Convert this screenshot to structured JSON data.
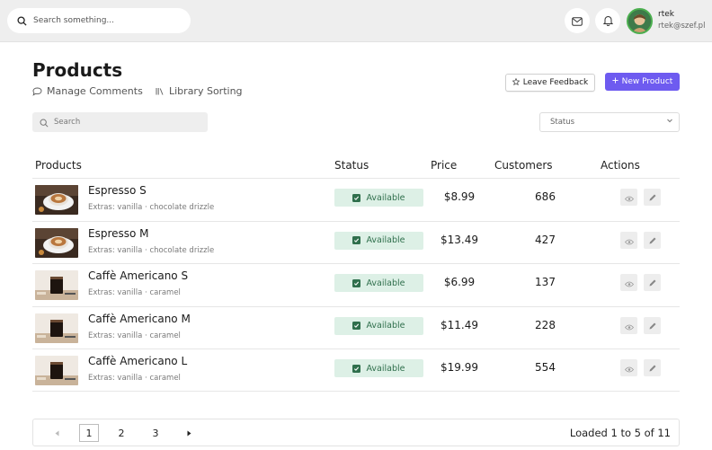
{
  "topbar": {
    "search_placeholder": "Search something...",
    "user": {
      "name": "rtek",
      "email": "rtek@szef.pl"
    }
  },
  "header": {
    "title": "Products",
    "links": {
      "manage_comments": "Manage Comments",
      "library_sorting": "Library Sorting"
    },
    "feedback_button": "Leave Feedback",
    "new_button": "New Product"
  },
  "filters": {
    "search_placeholder": "Search",
    "status_value": "Status"
  },
  "table": {
    "columns": {
      "products": "Products",
      "status": "Status",
      "price": "Price",
      "customers": "Customers",
      "actions": "Actions"
    },
    "rows": [
      {
        "name": "Espresso S",
        "extras": "Extras: vanilla · chocolate drizzle",
        "status": "Available",
        "price": "$8.99",
        "customers": "686",
        "image": "espresso-cup"
      },
      {
        "name": "Espresso M",
        "extras": "Extras: vanilla · chocolate drizzle",
        "status": "Available",
        "price": "$13.49",
        "customers": "427",
        "image": "espresso-cup"
      },
      {
        "name": "Caffè Americano S",
        "extras": "Extras: vanilla · caramel",
        "status": "Available",
        "price": "$6.99",
        "customers": "137",
        "image": "americano-glass"
      },
      {
        "name": "Caffè Americano M",
        "extras": "Extras: vanilla · caramel",
        "status": "Available",
        "price": "$11.49",
        "customers": "228",
        "image": "americano-glass"
      },
      {
        "name": "Caffè Americano L",
        "extras": "Extras: vanilla · caramel",
        "status": "Available",
        "price": "$19.99",
        "customers": "554",
        "image": "americano-glass"
      }
    ]
  },
  "pagination": {
    "pages": [
      "1",
      "2",
      "3"
    ],
    "current_page": "1",
    "info": "Loaded 1 to 5 of 11"
  },
  "colors": {
    "accent": "#6e5bf0",
    "status_bg": "#ddf0e6",
    "status_text": "#2f6f4c",
    "topbar_bg": "#eeeeee"
  },
  "icons": [
    "search-icon",
    "mail-icon",
    "bell-icon",
    "comment-icon",
    "library-icon",
    "star-icon",
    "plus-icon",
    "chevron-down-icon",
    "check-icon",
    "eye-icon",
    "pencil-icon",
    "prev-arrow-icon",
    "next-arrow-icon"
  ]
}
